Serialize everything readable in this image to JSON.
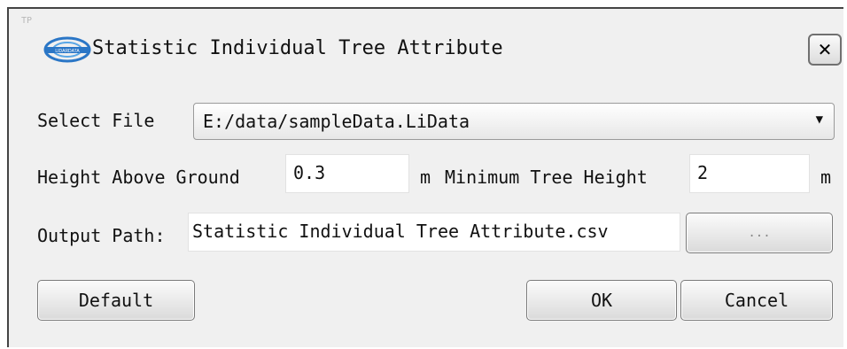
{
  "dialog": {
    "title": "Statistic Individual Tree Attribute",
    "ghost_text": "TP",
    "logo_text": "LIDARDATA",
    "close_symbol": "✕"
  },
  "form": {
    "select_file_label": "Select File",
    "select_file_value": "E:/data/sampleData.LiData",
    "height_above_ground_label": "Height Above Ground",
    "height_above_ground_value": "0.3",
    "unit_m": "m",
    "min_tree_height_label": "Minimum Tree Height",
    "min_tree_height_value": "2",
    "output_path_label": "Output Path:",
    "output_path_value": "Statistic Individual Tree Attribute.csv",
    "browse_label": "..."
  },
  "buttons": {
    "default_label": "Default",
    "ok_label": "OK",
    "cancel_label": "Cancel"
  },
  "colors": {
    "dialog_bg": "#f0f0f0",
    "logo_blue": "#2a76c6"
  }
}
